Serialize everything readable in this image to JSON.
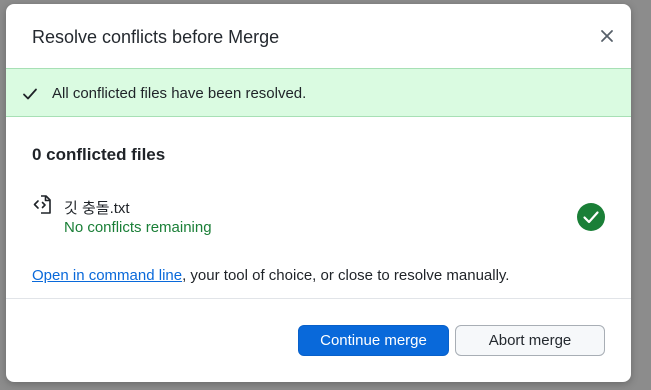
{
  "dialog": {
    "title": "Resolve conflicts before Merge",
    "close_icon": "close-icon"
  },
  "banner": {
    "icon": "check-icon",
    "message": "All conflicted files have been resolved.",
    "background": "#dafbe1"
  },
  "conflicts": {
    "heading": "0 conflicted files",
    "files": [
      {
        "icon": "file-diff-icon",
        "name": "깃 충돌.txt",
        "status": "No conflicts remaining",
        "status_icon": "check-circle-icon"
      }
    ]
  },
  "help": {
    "link_text": "Open in command line",
    "rest_text": ", your tool of choice, or close to resolve manually."
  },
  "footer": {
    "continue_label": "Continue merge",
    "abort_label": "Abort merge"
  },
  "colors": {
    "accent": "#0969da",
    "success": "#1a7f37"
  }
}
